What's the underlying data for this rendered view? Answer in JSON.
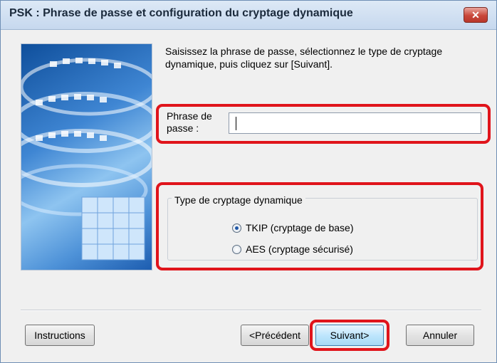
{
  "window": {
    "title": "PSK : Phrase de passe et configuration du cryptage dynamique",
    "close_symbol": "✕"
  },
  "content": {
    "intro_line1": "Saisissez la phrase de passe, sélectionnez le type de cryptage",
    "intro_line2": "dynamique, puis cliquez sur [Suivant].",
    "passphrase": {
      "label_line1": "Phrase de",
      "label_line2": "passe :",
      "value": ""
    },
    "encryption": {
      "group_label": "Type de cryptage dynamique",
      "options": [
        {
          "label": "TKIP (cryptage de base)",
          "selected": true
        },
        {
          "label": "AES (cryptage sécurisé)",
          "selected": false
        }
      ]
    }
  },
  "buttons": {
    "instructions": "Instructions",
    "back": "<Précédent",
    "next": "Suivant>",
    "cancel": "Annuler"
  },
  "colors": {
    "highlight": "#e0141b",
    "title_bar": "#c6d8ee",
    "dialog_bg": "#f0f0f0"
  },
  "icons": {
    "close": "close-icon",
    "art": "printer-wireless-illustration"
  }
}
